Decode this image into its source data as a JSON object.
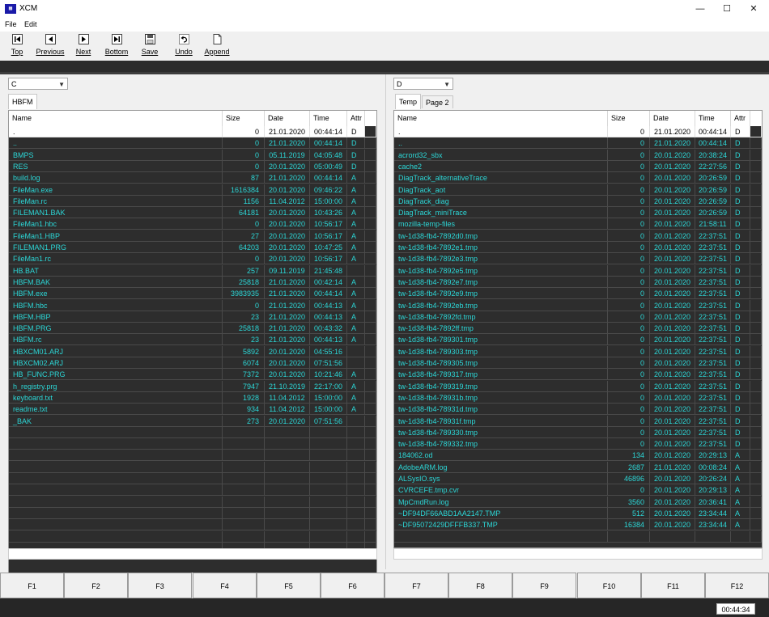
{
  "window": {
    "title": "XCM",
    "icon": "XCM-app-icon"
  },
  "menu": [
    {
      "label": "File"
    },
    {
      "label": "Edit"
    }
  ],
  "toolbar": [
    {
      "label": "Top",
      "icon": "first-icon"
    },
    {
      "label": "Previous",
      "icon": "prev-icon"
    },
    {
      "label": "Next",
      "icon": "next-icon"
    },
    {
      "label": "Bottom",
      "icon": "last-icon"
    },
    {
      "label": "Save",
      "icon": "floppy-icon"
    },
    {
      "label": "Undo",
      "icon": "undo-icon"
    },
    {
      "label": "Append",
      "icon": "page-icon"
    }
  ],
  "columns": [
    "Name",
    "Size",
    "Date",
    "Time",
    "Attr"
  ],
  "left_panel": {
    "drive": "C",
    "tabs": [
      "HBFM"
    ],
    "rows": [
      [
        ".",
        "0",
        "21.01.2020",
        "00:44:14",
        "D"
      ],
      [
        "..",
        "0",
        "21.01.2020",
        "00:44:14",
        "D"
      ],
      [
        "BMPS",
        "0",
        "05.11.2019",
        "04:05:48",
        "D"
      ],
      [
        "RES",
        "0",
        "20.01.2020",
        "05:00:49",
        "D"
      ],
      [
        "build.log",
        "87",
        "21.01.2020",
        "00:44:14",
        "A"
      ],
      [
        "FileMan.exe",
        "1616384",
        "20.01.2020",
        "09:46:22",
        "A"
      ],
      [
        "FileMan.rc",
        "1156",
        "11.04.2012",
        "15:00:00",
        "A"
      ],
      [
        "FILEMAN1.BAK",
        "64181",
        "20.01.2020",
        "10:43:26",
        "A"
      ],
      [
        "FileMan1.hbc",
        "0",
        "20.01.2020",
        "10:56:17",
        "A"
      ],
      [
        "FileMan1.HBP",
        "27",
        "20.01.2020",
        "10:56:17",
        "A"
      ],
      [
        "FILEMAN1.PRG",
        "64203",
        "20.01.2020",
        "10:47:25",
        "A"
      ],
      [
        "FileMan1.rc",
        "0",
        "20.01.2020",
        "10:56:17",
        "A"
      ],
      [
        "HB.BAT",
        "257",
        "09.11.2019",
        "21:45:48",
        ""
      ],
      [
        "HBFM.BAK",
        "25818",
        "21.01.2020",
        "00:42:14",
        "A"
      ],
      [
        "HBFM.exe",
        "3983935",
        "21.01.2020",
        "00:44:14",
        "A"
      ],
      [
        "HBFM.hbc",
        "0",
        "21.01.2020",
        "00:44:13",
        "A"
      ],
      [
        "HBFM.HBP",
        "23",
        "21.01.2020",
        "00:44:13",
        "A"
      ],
      [
        "HBFM.PRG",
        "25818",
        "21.01.2020",
        "00:43:32",
        "A"
      ],
      [
        "HBFM.rc",
        "23",
        "21.01.2020",
        "00:44:13",
        "A"
      ],
      [
        "HBXCM01.ARJ",
        "5892",
        "20.01.2020",
        "04:55:16",
        ""
      ],
      [
        "HBXCM02.ARJ",
        "6074",
        "20.01.2020",
        "07:51:56",
        ""
      ],
      [
        "HB_FUNC.PRG",
        "7372",
        "20.01.2020",
        "10:21:46",
        "A"
      ],
      [
        "h_registry.prg",
        "7947",
        "21.10.2019",
        "22:17:00",
        "A"
      ],
      [
        "keyboard.txt",
        "1928",
        "11.04.2012",
        "15:00:00",
        "A"
      ],
      [
        "readme.txt",
        "934",
        "11.04.2012",
        "15:00:00",
        "A"
      ],
      [
        "_BAK",
        "273",
        "20.01.2020",
        "07:51:56",
        ""
      ]
    ]
  },
  "right_panel": {
    "drive": "D",
    "tabs": [
      "Temp",
      "Page 2"
    ],
    "rows": [
      [
        ".",
        "0",
        "21.01.2020",
        "00:44:14",
        "D"
      ],
      [
        "..",
        "0",
        "21.01.2020",
        "00:44:14",
        "D"
      ],
      [
        "acrord32_sbx",
        "0",
        "20.01.2020",
        "20:38:24",
        "D"
      ],
      [
        "cache2",
        "0",
        "20.01.2020",
        "22:27:56",
        "D"
      ],
      [
        "DiagTrack_alternativeTrace",
        "0",
        "20.01.2020",
        "20:26:59",
        "D"
      ],
      [
        "DiagTrack_aot",
        "0",
        "20.01.2020",
        "20:26:59",
        "D"
      ],
      [
        "DiagTrack_diag",
        "0",
        "20.01.2020",
        "20:26:59",
        "D"
      ],
      [
        "DiagTrack_miniTrace",
        "0",
        "20.01.2020",
        "20:26:59",
        "D"
      ],
      [
        "mozilla-temp-files",
        "0",
        "20.01.2020",
        "21:58:11",
        "D"
      ],
      [
        "tw-1d38-fb4-7892d0.tmp",
        "0",
        "20.01.2020",
        "22:37:51",
        "D"
      ],
      [
        "tw-1d38-fb4-7892e1.tmp",
        "0",
        "20.01.2020",
        "22:37:51",
        "D"
      ],
      [
        "tw-1d38-fb4-7892e3.tmp",
        "0",
        "20.01.2020",
        "22:37:51",
        "D"
      ],
      [
        "tw-1d38-fb4-7892e5.tmp",
        "0",
        "20.01.2020",
        "22:37:51",
        "D"
      ],
      [
        "tw-1d38-fb4-7892e7.tmp",
        "0",
        "20.01.2020",
        "22:37:51",
        "D"
      ],
      [
        "tw-1d38-fb4-7892e9.tmp",
        "0",
        "20.01.2020",
        "22:37:51",
        "D"
      ],
      [
        "tw-1d38-fb4-7892eb.tmp",
        "0",
        "20.01.2020",
        "22:37:51",
        "D"
      ],
      [
        "tw-1d38-fb4-7892fd.tmp",
        "0",
        "20.01.2020",
        "22:37:51",
        "D"
      ],
      [
        "tw-1d38-fb4-7892ff.tmp",
        "0",
        "20.01.2020",
        "22:37:51",
        "D"
      ],
      [
        "tw-1d38-fb4-789301.tmp",
        "0",
        "20.01.2020",
        "22:37:51",
        "D"
      ],
      [
        "tw-1d38-fb4-789303.tmp",
        "0",
        "20.01.2020",
        "22:37:51",
        "D"
      ],
      [
        "tw-1d38-fb4-789305.tmp",
        "0",
        "20.01.2020",
        "22:37:51",
        "D"
      ],
      [
        "tw-1d38-fb4-789317.tmp",
        "0",
        "20.01.2020",
        "22:37:51",
        "D"
      ],
      [
        "tw-1d38-fb4-789319.tmp",
        "0",
        "20.01.2020",
        "22:37:51",
        "D"
      ],
      [
        "tw-1d38-fb4-78931b.tmp",
        "0",
        "20.01.2020",
        "22:37:51",
        "D"
      ],
      [
        "tw-1d38-fb4-78931d.tmp",
        "0",
        "20.01.2020",
        "22:37:51",
        "D"
      ],
      [
        "tw-1d38-fb4-78931f.tmp",
        "0",
        "20.01.2020",
        "22:37:51",
        "D"
      ],
      [
        "tw-1d38-fb4-789330.tmp",
        "0",
        "20.01.2020",
        "22:37:51",
        "D"
      ],
      [
        "tw-1d38-fb4-789332.tmp",
        "0",
        "20.01.2020",
        "22:37:51",
        "D"
      ],
      [
        "184062.od",
        "134",
        "20.01.2020",
        "20:29:13",
        "A"
      ],
      [
        "AdobeARM.log",
        "2687",
        "21.01.2020",
        "00:08:24",
        "A"
      ],
      [
        "ALSysIO.sys",
        "46896",
        "20.01.2020",
        "20:26:24",
        "A"
      ],
      [
        "CVRCEFE.tmp.cvr",
        "0",
        "20.01.2020",
        "20:29:13",
        "A"
      ],
      [
        "MpCmdRun.log",
        "3560",
        "20.01.2020",
        "20:36:41",
        "A"
      ],
      [
        "~DF94DF66ABD1AA2147.TMP",
        "512",
        "20.01.2020",
        "23:34:44",
        "A"
      ],
      [
        "~DF95072429DFFFB337.TMP",
        "16384",
        "20.01.2020",
        "23:34:44",
        "A"
      ]
    ]
  },
  "fkeys": [
    "F1",
    "F2",
    "F3",
    "F4",
    "F5",
    "F6",
    "F7",
    "F8",
    "F9",
    "F10",
    "F11",
    "F12"
  ],
  "clock": "00:44:34",
  "colors": {
    "grid_bg": "#2d2d2d",
    "grid_text": "#2cd6d6",
    "selected_bg": "#ffffff"
  }
}
